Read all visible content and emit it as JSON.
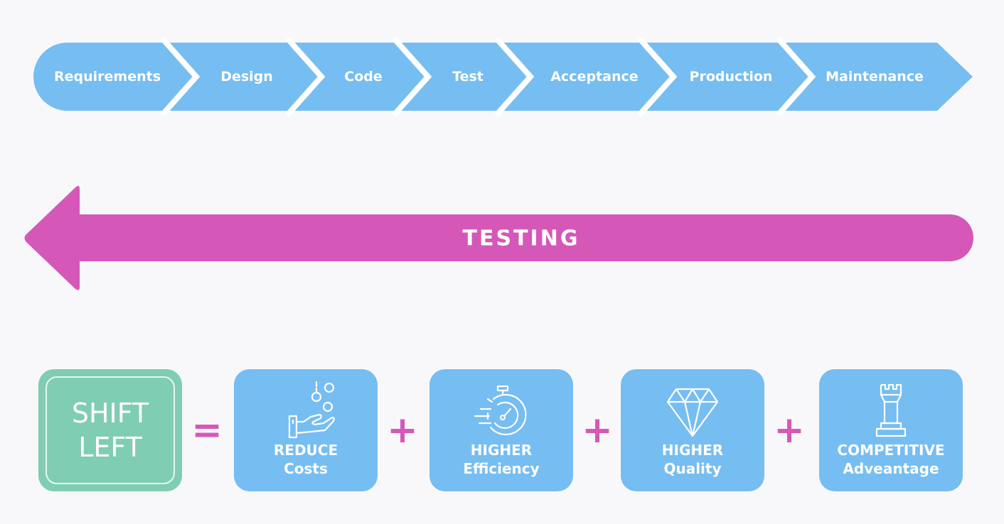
{
  "pipeline": {
    "color": "#76bdf2",
    "stages": [
      {
        "label": "Requirements"
      },
      {
        "label": "Design"
      },
      {
        "label": "Code"
      },
      {
        "label": "Test"
      },
      {
        "label": "Acceptance"
      },
      {
        "label": "Production"
      },
      {
        "label": "Maintenance"
      }
    ]
  },
  "testing_arrow": {
    "label": "TESTING",
    "direction": "left",
    "color": "#d558b9"
  },
  "equation": {
    "lhs": {
      "line1": "SHIFT",
      "line2": "LEFT",
      "color": "#7fcdb3"
    },
    "equals": "=",
    "plus": "+",
    "operator_color": "#d558b9",
    "benefits": [
      {
        "icon": "hand-coins-icon",
        "line1": "REDUCE",
        "line2": "Costs"
      },
      {
        "icon": "stopwatch-icon",
        "line1": "HIGHER",
        "line2": "Efficiency"
      },
      {
        "icon": "diamond-icon",
        "line1": "HIGHER",
        "line2": "Quality"
      },
      {
        "icon": "chess-rook-icon",
        "line1": "COMPETITIVE",
        "line2": "Adveantage"
      }
    ],
    "benefit_color": "#76bdf2"
  }
}
